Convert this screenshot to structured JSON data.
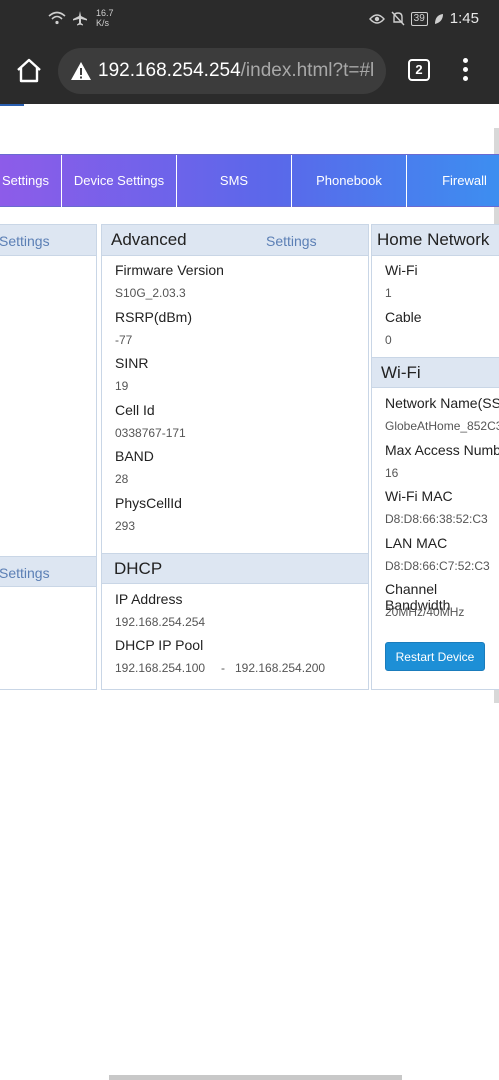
{
  "status_bar": {
    "speed_value": "16.7",
    "speed_unit": "K/s",
    "battery": "39",
    "time": "1:45",
    "icons": [
      "wifi-icon",
      "airplane-icon",
      "eye-icon",
      "bell-off-icon",
      "battery-icon",
      "leaf-icon"
    ]
  },
  "browser": {
    "url_host": "192.168.254.254",
    "url_path": "/index.html?t=#l",
    "tab_count": "2",
    "icons": [
      "home-icon",
      "warning-icon",
      "tabs-icon",
      "menu-icon"
    ]
  },
  "nav": {
    "items": [
      {
        "label": "Settings"
      },
      {
        "label": "Device Settings"
      },
      {
        "label": "SMS"
      },
      {
        "label": "Phonebook"
      },
      {
        "label": "Firewall"
      }
    ]
  },
  "left_panel": {
    "settings_link_1": "Settings",
    "settings_link_2": "Settings"
  },
  "advanced": {
    "title": "Advanced",
    "settings_link": "Settings",
    "fields": [
      {
        "label": "Firmware Version",
        "value": "S10G_2.03.3"
      },
      {
        "label": "RSRP(dBm)",
        "value": "-77"
      },
      {
        "label": "SINR",
        "value": "19"
      },
      {
        "label": "Cell Id",
        "value": "0338767-171"
      },
      {
        "label": "BAND",
        "value": "28"
      },
      {
        "label": "PhysCellId",
        "value": "293"
      }
    ]
  },
  "dhcp": {
    "title": "DHCP",
    "ip_label": "IP Address",
    "ip_value": "192.168.254.254",
    "pool_label": "DHCP IP Pool",
    "pool_start": "192.168.254.100",
    "pool_sep": "-",
    "pool_end": "192.168.254.200"
  },
  "home_network": {
    "title": "Home Network",
    "fields": [
      {
        "label": "Wi-Fi",
        "value": "1"
      },
      {
        "label": "Cable",
        "value": "0"
      }
    ]
  },
  "wifi": {
    "title": "Wi-Fi",
    "fields": [
      {
        "label": "Network Name(SS",
        "value": "GlobeAtHome_852C3"
      },
      {
        "label": "Max Access Numb",
        "value": "16"
      },
      {
        "label": "Wi-Fi MAC",
        "value": "D8:D8:66:38:52:C3"
      },
      {
        "label": "LAN MAC",
        "value": "D8:D8:66:C7:52:C3"
      },
      {
        "label": "Channel Bandwidth",
        "value": "20MHz/40MHz"
      }
    ],
    "restart_label": "Restart Device"
  }
}
